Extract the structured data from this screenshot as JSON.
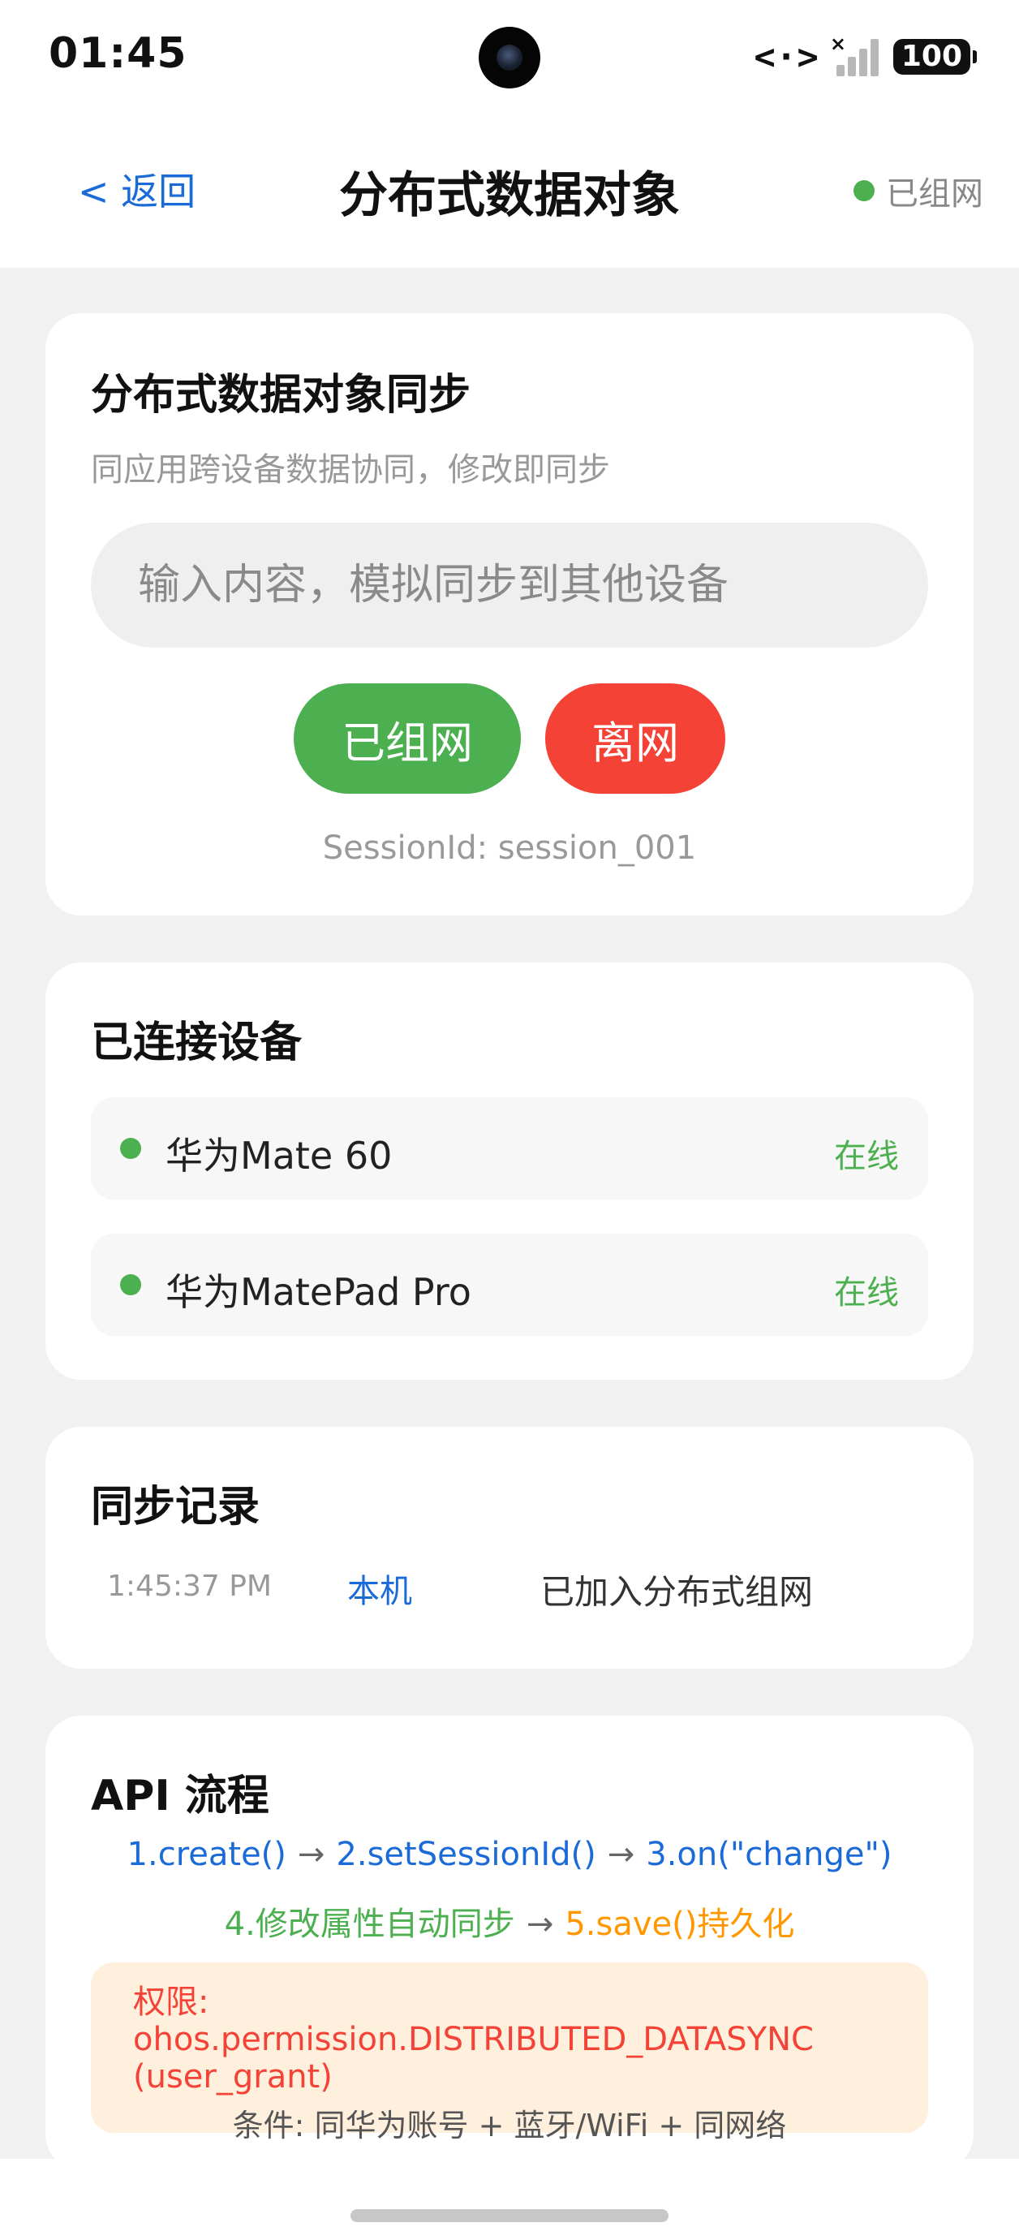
{
  "status_bar": {
    "time": "01:45",
    "battery": "100"
  },
  "header": {
    "back_label": "< 返回",
    "title": "分布式数据对象",
    "network_status": "已组网",
    "network_status_color": "#4caf50"
  },
  "sync_card": {
    "title": "分布式数据对象同步",
    "subtitle": "同应用跨设备数据协同，修改即同步",
    "input_value": "",
    "input_placeholder": "输入内容，模拟同步到其他设备",
    "join_button": "已组网",
    "leave_button": "离网",
    "session": "SessionId: session_001"
  },
  "devices_card": {
    "title": "已连接设备",
    "devices": [
      {
        "name": "华为Mate 60",
        "state": "在线"
      },
      {
        "name": "华为MatePad Pro",
        "state": "在线"
      }
    ]
  },
  "log_card": {
    "title": "同步记录",
    "entries": [
      {
        "time": "1:45:37 PM",
        "source": "本机",
        "message": "已加入分布式组网"
      }
    ]
  },
  "api_card": {
    "title": "API 流程",
    "steps": [
      "1.create()",
      "2.setSessionId()",
      "3.on(\"change\")",
      "4.修改属性自动同步",
      "5.save()持久化"
    ],
    "arrow": "→",
    "permission": "权限: ohos.permission.DISTRIBUTED_DATASYNC (user_grant)",
    "conditions": "条件: 同华为账号 + 蓝牙/WiFi + 同网络"
  },
  "colors": {
    "accent_blue": "#1a6ad8",
    "green": "#4caf50",
    "red": "#f44336",
    "orange": "#ff9800"
  }
}
